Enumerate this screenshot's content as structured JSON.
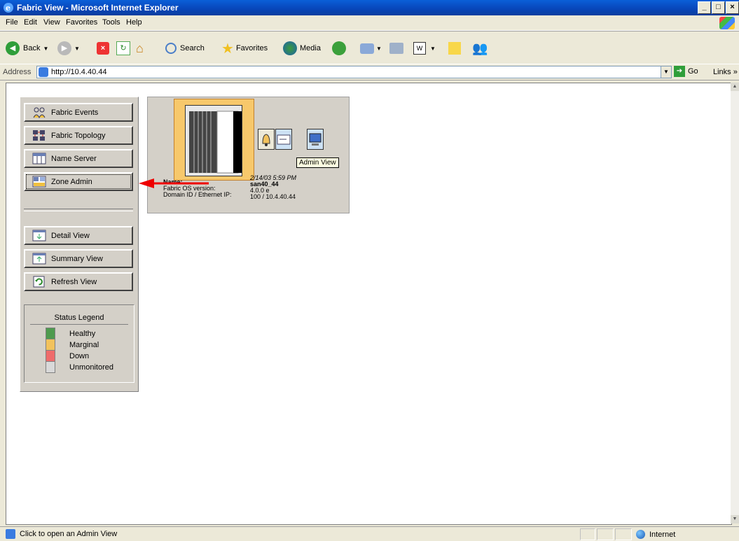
{
  "window": {
    "title": "Fabric View - Microsoft Internet Explorer",
    "controls": [
      "_",
      "□",
      "×"
    ]
  },
  "menu": [
    "File",
    "Edit",
    "View",
    "Favorites",
    "Tools",
    "Help"
  ],
  "toolbar": {
    "back": "Back",
    "search": "Search",
    "favorites": "Favorites",
    "media": "Media"
  },
  "address": {
    "label": "Address",
    "url": "http://10.4.40.44",
    "go": "Go",
    "links": "Links"
  },
  "left_panel": {
    "nav": [
      {
        "label": "Fabric Events",
        "icon": "fabric-events-icon"
      },
      {
        "label": "Fabric Topology",
        "icon": "fabric-topology-icon"
      },
      {
        "label": "Name Server",
        "icon": "name-server-icon"
      },
      {
        "label": "Zone Admin",
        "icon": "zone-admin-icon"
      }
    ],
    "views": [
      {
        "label": "Detail View",
        "icon": "detail-view-icon"
      },
      {
        "label": "Summary View",
        "icon": "summary-view-icon"
      },
      {
        "label": "Refresh View",
        "icon": "refresh-icon"
      }
    ],
    "legend": {
      "title": "Status Legend",
      "items": [
        {
          "label": "Healthy",
          "color": "#4e9a4e"
        },
        {
          "label": "Marginal",
          "color": "#f2c25c"
        },
        {
          "label": "Down",
          "color": "#ef6b6b"
        },
        {
          "label": "Unmonitored",
          "color": "#d9d9d9"
        }
      ]
    }
  },
  "switch": {
    "tooltip": "Admin View",
    "info_labels": [
      "Name:",
      "Fabric OS version:",
      "Domain ID / Ethernet IP:"
    ],
    "info_values": [
      "2/14/03 5:59 PM",
      "san40_44",
      "4.0.0 e",
      "100 / 10.4.40.44"
    ]
  },
  "status": {
    "text": "Click to open an Admin View",
    "zone": "Internet"
  }
}
